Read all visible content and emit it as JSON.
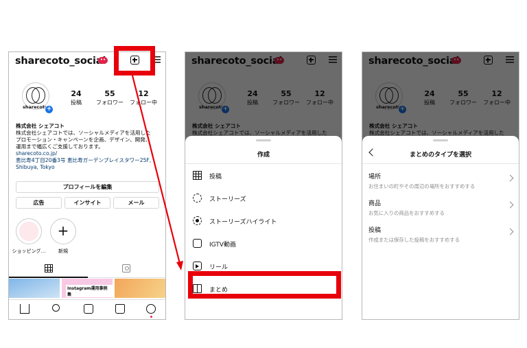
{
  "profile": {
    "username": "sharecoto_social",
    "badge": "••",
    "avatar_label": "sharecoto",
    "stats": [
      {
        "num": "24",
        "label": "投稿"
      },
      {
        "num": "55",
        "label": "フォロワー"
      },
      {
        "num": "12",
        "label": "フォロー中"
      }
    ],
    "name": "株式会社 シェアコト",
    "bio_lines": [
      "株式会社シェアコトでは、ソーシャルメディアを活用した",
      "プロモーション・キャンペーンを企画、デザイン、開発、",
      "運用まで幅広くご支援しております。"
    ],
    "link": "sharecoto.co.jp/",
    "address_lines": [
      "恵比寿4丁目20番3号 恵比寿ガーデンプレイスタワー25F,",
      "Shibuya, Tokyo"
    ],
    "edit_profile": "プロフィールを編集",
    "buttons": [
      "広告",
      "インサイト",
      "メール"
    ],
    "highlights": [
      {
        "label": "ショッピング…"
      },
      {
        "label": "新規"
      }
    ],
    "thumb_text": "Instagram運用事例集"
  },
  "create_sheet": {
    "title": "作成",
    "items": [
      {
        "label": "投稿",
        "icon": "grid-icon"
      },
      {
        "label": "ストーリーズ",
        "icon": "story-icon"
      },
      {
        "label": "ストーリーズハイライト",
        "icon": "highlight-icon"
      },
      {
        "label": "IGTV動画",
        "icon": "igtv-icon"
      },
      {
        "label": "リール",
        "icon": "reels-icon"
      },
      {
        "label": "まとめ",
        "icon": "guide-icon"
      }
    ]
  },
  "guide_sheet": {
    "title": "まとめのタイプを選択",
    "types": [
      {
        "title": "場所",
        "desc": "お住まいの町やその周辺の場所をおすすめする"
      },
      {
        "title": "商品",
        "desc": "お気に入りの商品をおすすめする"
      },
      {
        "title": "投稿",
        "desc": "作成または保存した投稿をおすすめする"
      }
    ]
  },
  "colors": {
    "highlight_red": "#e8000b",
    "link_blue": "#00376b",
    "badge_red": "#e0234b",
    "accent_blue": "#1b74e4"
  }
}
